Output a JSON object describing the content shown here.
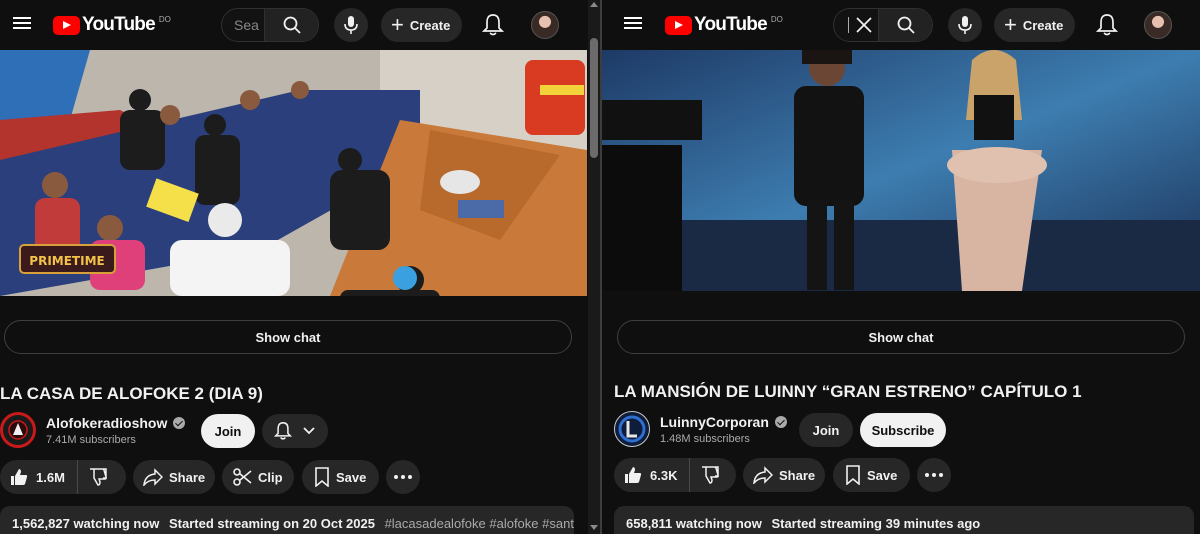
{
  "left": {
    "masthead": {
      "brand": "YouTube",
      "region": "DO",
      "search_placeholder": "Sea",
      "create_label": "Create"
    },
    "show_chat_label": "Show chat",
    "video_title": "LA CASA DE ALOFOKE 2 (DIA 9)",
    "overlay_logo_text": "PRIMETIME",
    "channel": {
      "name": "Alofokeradioshow",
      "subscribers": "7.41M subscribers",
      "verified": true
    },
    "join_label": "Join",
    "actions": {
      "likes": "1.6M",
      "share": "Share",
      "clip": "Clip",
      "save": "Save"
    },
    "description": {
      "watching": "1,562,827 watching now",
      "started": "Started streaming on 20 Oct 2025",
      "hashtags": "#lacasadealofoke #alofoke #santiago"
    }
  },
  "right": {
    "masthead": {
      "brand": "YouTube",
      "region": "DO",
      "create_label": "Create"
    },
    "show_chat_label": "Show chat",
    "video_title": "LA MANSIÓN DE LUINNY “GRAN ESTRENO” CAPÍTULO 1",
    "channel": {
      "name": "LuinnyCorporan",
      "subscribers": "1.48M subscribers",
      "verified": true
    },
    "join_label": "Join",
    "subscribe_label": "Subscribe",
    "actions": {
      "likes": "6.3K",
      "share": "Share",
      "save": "Save"
    },
    "description": {
      "watching": "658,811 watching now",
      "started": "Started streaming 39 minutes ago"
    }
  },
  "colors": {
    "background": "#0f0f0f",
    "button": "#272727",
    "brand_red": "#ff0000",
    "secondary_text": "#aaaaaa"
  },
  "icons": [
    "hamburger-icon",
    "youtube-logo",
    "search-icon",
    "clear-icon",
    "mic-icon",
    "plus-icon",
    "bell-icon",
    "chevron-down-icon",
    "thumbs-up-icon",
    "thumbs-down-icon",
    "share-icon",
    "scissors-icon",
    "bookmark-icon",
    "more-icon",
    "verified-icon"
  ]
}
